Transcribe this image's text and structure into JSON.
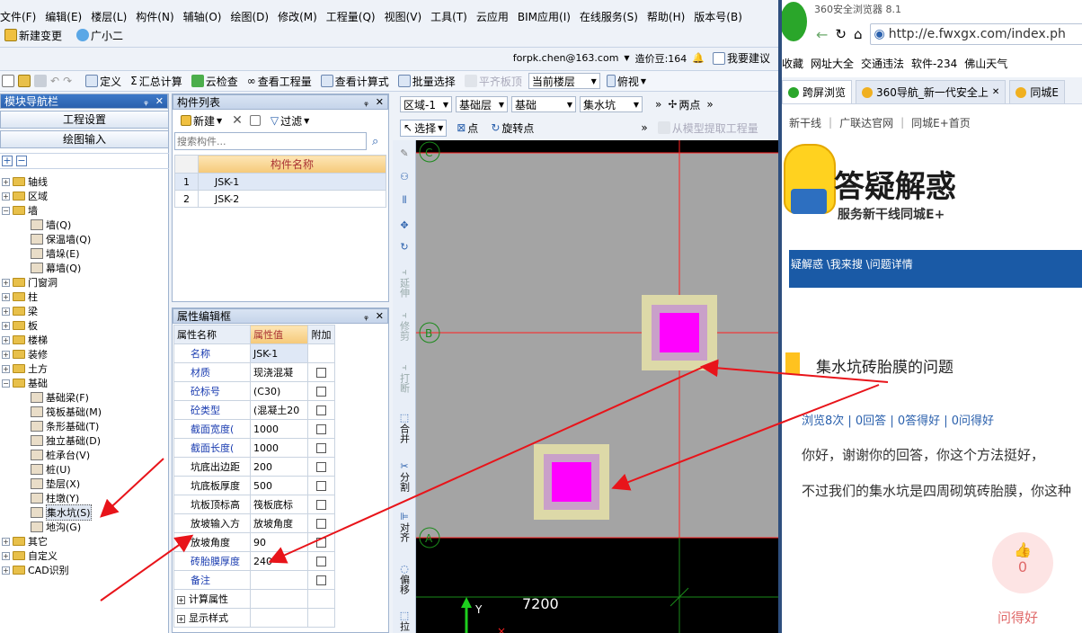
{
  "app": {
    "menu": [
      "文件(F)",
      "编辑(E)",
      "楼层(L)",
      "构件(N)",
      "辅轴(O)",
      "绘图(D)",
      "修改(M)",
      "工程量(Q)",
      "视图(V)",
      "工具(T)",
      "云应用",
      "BIM应用(I)",
      "在线服务(S)",
      "帮助(H)",
      "版本号(B)"
    ],
    "bar2": {
      "new_change": "新建变更",
      "assistant": "广小二"
    },
    "bar3": {
      "account": "forpk.chen@163.com",
      "price_beans": "造价豆:164",
      "suggest": "我要建议"
    },
    "toolbar": {
      "define": "定义",
      "sum_calc": "汇总计算",
      "cloud_check": "云检查",
      "view_quantity": "查看工程量",
      "view_formula": "查看计算式",
      "batch_select": "批量选择",
      "flush_top": "平齐板顶",
      "floor_select": "当前楼层",
      "view_mode": "俯视"
    },
    "nav": {
      "title": "模块导航栏",
      "project_settings": "工程设置",
      "drawing_input": "绘图输入",
      "tree": [
        {
          "label": "轴线",
          "expand": "+",
          "level": 0
        },
        {
          "label": "区域",
          "expand": "+",
          "level": 0
        },
        {
          "label": "墙",
          "expand": "-",
          "level": 0
        },
        {
          "label": "墙(Q)",
          "level": 1
        },
        {
          "label": "保温墙(Q)",
          "level": 1
        },
        {
          "label": "墙垛(E)",
          "level": 1
        },
        {
          "label": "幕墙(Q)",
          "level": 1
        },
        {
          "label": "门窗洞",
          "expand": "+",
          "level": 0
        },
        {
          "label": "柱",
          "expand": "+",
          "level": 0
        },
        {
          "label": "梁",
          "expand": "+",
          "level": 0
        },
        {
          "label": "板",
          "expand": "+",
          "level": 0
        },
        {
          "label": "楼梯",
          "expand": "+",
          "level": 0
        },
        {
          "label": "装修",
          "expand": "+",
          "level": 0
        },
        {
          "label": "土方",
          "expand": "+",
          "level": 0
        },
        {
          "label": "基础",
          "expand": "-",
          "level": 0
        },
        {
          "label": "基础梁(F)",
          "level": 1
        },
        {
          "label": "筏板基础(M)",
          "level": 1
        },
        {
          "label": "条形基础(T)",
          "level": 1
        },
        {
          "label": "独立基础(D)",
          "level": 1
        },
        {
          "label": "桩承台(V)",
          "level": 1
        },
        {
          "label": "桩(U)",
          "level": 1
        },
        {
          "label": "垫层(X)",
          "level": 1
        },
        {
          "label": "柱墩(Y)",
          "level": 1
        },
        {
          "label": "集水坑(S)",
          "level": 1,
          "selected": true
        },
        {
          "label": "地沟(G)",
          "level": 1
        },
        {
          "label": "其它",
          "expand": "+",
          "level": 0
        },
        {
          "label": "自定义",
          "expand": "+",
          "level": 0
        },
        {
          "label": "CAD识别",
          "expand": "+",
          "level": 0
        }
      ]
    },
    "complist": {
      "title": "构件列表",
      "new_btn": "新建",
      "filter_btn": "过滤",
      "search_placeholder": "搜索构件...",
      "col_header": "构件名称",
      "rows": [
        {
          "idx": "1",
          "name": "JSK-1"
        },
        {
          "idx": "2",
          "name": "JSK-2"
        }
      ]
    },
    "props": {
      "title": "属性编辑框",
      "headers": {
        "name": "属性名称",
        "value": "属性值",
        "extra": "附加"
      },
      "rows": [
        {
          "name": "名称",
          "value": "JSK-1",
          "blue": true,
          "chk": false
        },
        {
          "name": "材质",
          "value": "现浇混凝",
          "blue": true,
          "chk": true
        },
        {
          "name": "砼标号",
          "value": "(C30)",
          "blue": true,
          "chk": true
        },
        {
          "name": "砼类型",
          "value": "(混凝土20",
          "blue": true,
          "chk": true
        },
        {
          "name": "截面宽度(",
          "value": "1000",
          "blue": true,
          "chk": true
        },
        {
          "name": "截面长度(",
          "value": "1000",
          "blue": true,
          "chk": true
        },
        {
          "name": "坑底出边距",
          "value": "200",
          "blue": false,
          "chk": true
        },
        {
          "name": "坑底板厚度",
          "value": "500",
          "blue": false,
          "chk": true
        },
        {
          "name": "坑板顶标高",
          "value": "筏板底标",
          "blue": false,
          "chk": true
        },
        {
          "name": "放坡输入方",
          "value": "放坡角度",
          "blue": false,
          "chk": true
        },
        {
          "name": "放坡角度",
          "value": "90",
          "blue": false,
          "chk": true
        },
        {
          "name": "砖胎膜厚度",
          "value": "240",
          "blue": true,
          "chk": true
        },
        {
          "name": "备注",
          "value": "",
          "blue": true,
          "chk": true
        },
        {
          "name": "计算属性",
          "value": "",
          "group": true
        },
        {
          "name": "显示样式",
          "value": "",
          "group": true
        }
      ]
    },
    "drawbar": {
      "region": "区域-1",
      "layer": "基础层",
      "category": "基础",
      "type": "集水坑",
      "two_points": "两点",
      "select": "选择",
      "point": "点",
      "rotate_point": "旋转点",
      "extract": "从模型提取工程量"
    },
    "vtools": [
      "延伸",
      "修剪",
      "打断",
      "合并",
      "分割",
      "对齐",
      "偏移",
      "拉"
    ],
    "canvas": {
      "axis_c": "C",
      "axis_b": "B",
      "axis_a": "A",
      "dim": "7200",
      "y_label": "Y"
    }
  },
  "browser": {
    "title": "360安全浏览器 8.1",
    "url": "http://e.fwxgx.com/index.ph",
    "favorites": [
      "收藏",
      "网址大全",
      "交通违法",
      "软件-234",
      "佛山天气"
    ],
    "tabs": [
      {
        "label": "跨屏浏览"
      },
      {
        "label": "360导航_新一代安全上"
      },
      {
        "label": "同城E"
      }
    ],
    "site_nav": [
      "新干线",
      "广联达官网",
      "同城E+首页"
    ],
    "banner_title": "答疑解惑",
    "banner_sub": "服务新干线同城E+",
    "breadcrumb": "疑解惑 \\我来搜 \\问题详情",
    "question_title": "集水坑砖胎膜的问题",
    "stats": "浏览8次 | 0回答 | 0答得好 | 0问得好",
    "para1": "你好，谢谢你的回答，你这个方法挺好，",
    "para2": "不过我们的集水坑是四周砌筑砖胎膜，你这种",
    "like_count": "0",
    "like_label": "问得好"
  }
}
